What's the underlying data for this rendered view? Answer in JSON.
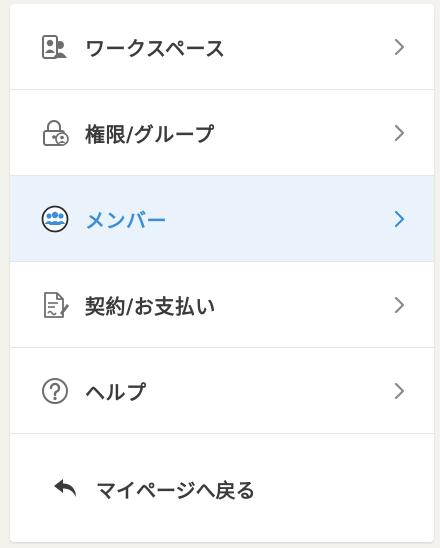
{
  "colors": {
    "active_text": "#3a8fd6",
    "active_background": "#eaf3fb",
    "text": "#3b3b3b",
    "icon": "#6e6e6e",
    "chevron": "#8a8a8a"
  },
  "menu": {
    "items": [
      {
        "label": "ワークスペース",
        "icon": "users-icon",
        "active": false
      },
      {
        "label": "権限/グループ",
        "icon": "lock-user-icon",
        "active": false
      },
      {
        "label": "メンバー",
        "icon": "member-group-icon",
        "active": true
      },
      {
        "label": "契約/お支払い",
        "icon": "contract-document-icon",
        "active": false
      },
      {
        "label": "ヘルプ",
        "icon": "help-circle-icon",
        "active": false
      }
    ]
  },
  "back": {
    "label": "マイページへ戻る",
    "icon": "back-arrow-icon"
  }
}
